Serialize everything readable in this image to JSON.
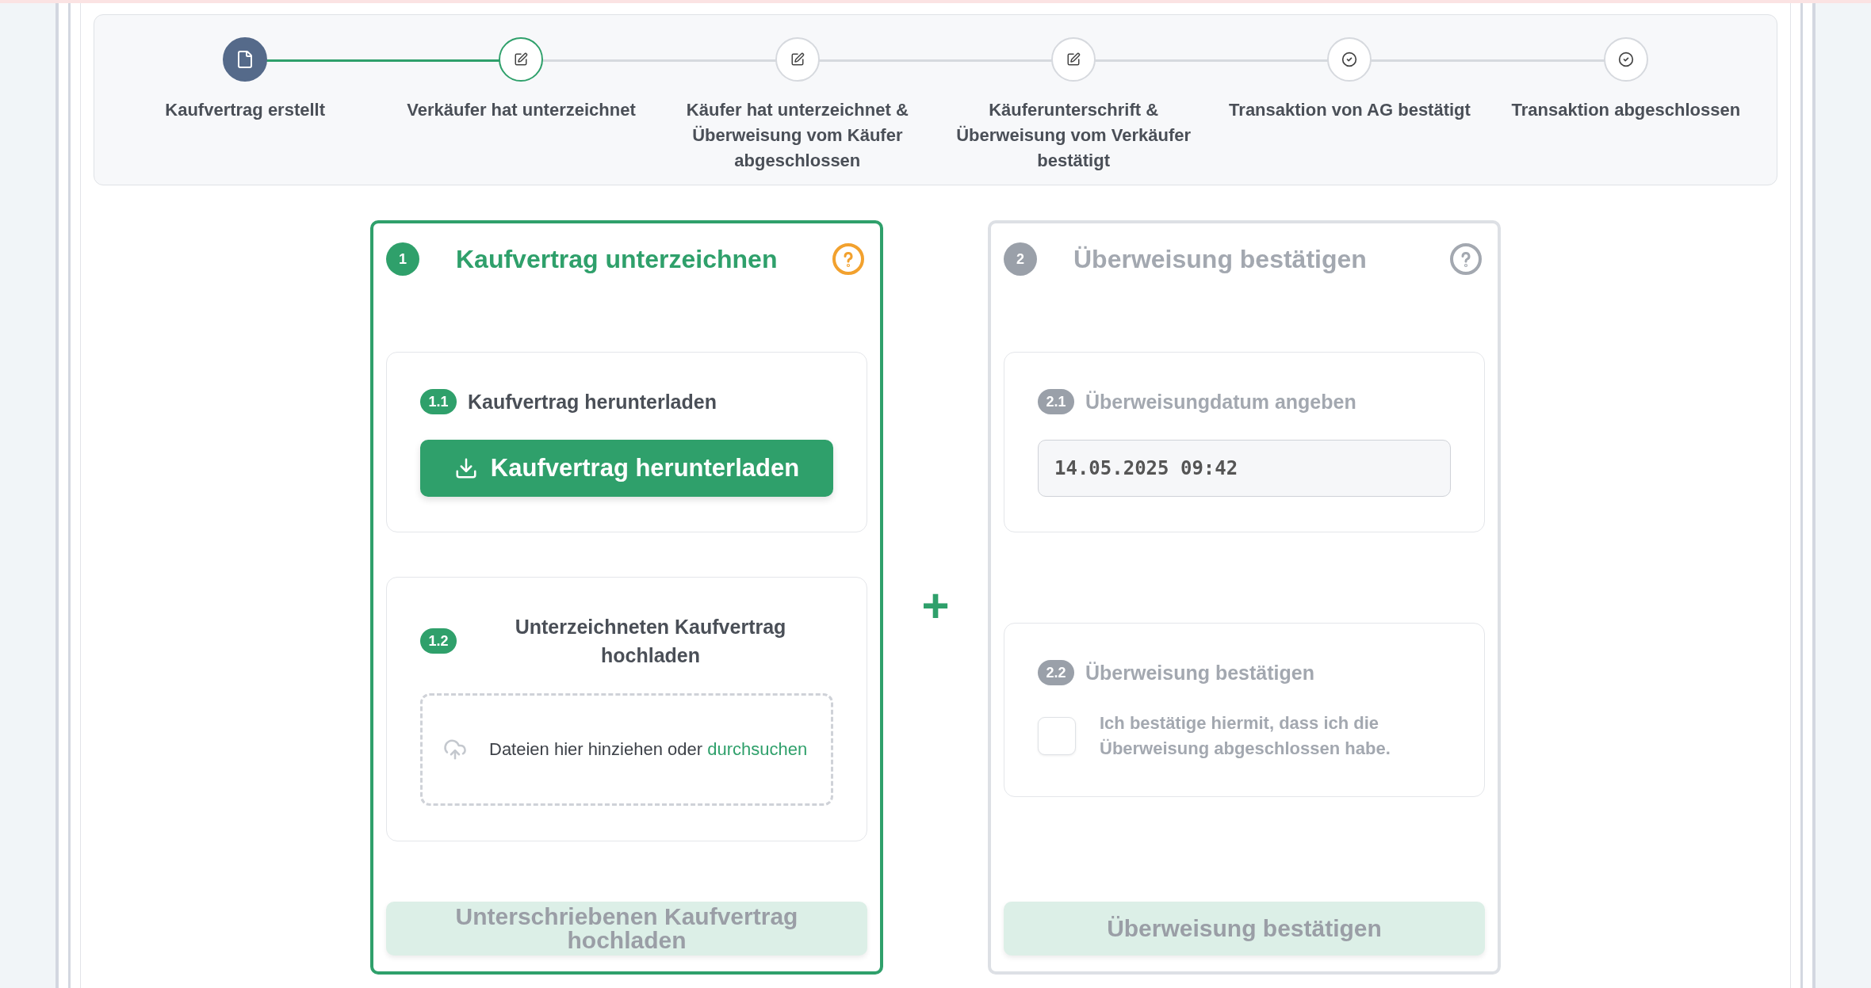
{
  "steps": [
    {
      "label": "Kaufvertrag erstellt",
      "done": true,
      "selected": false,
      "kind": "document"
    },
    {
      "label": "Verkäufer hat unterzeichnet",
      "done": false,
      "selected": true,
      "kind": "edit"
    },
    {
      "label": "Käufer hat unterzeichnet & Überweisung vom Käufer abgeschlossen",
      "done": false,
      "selected": false,
      "kind": "edit"
    },
    {
      "label": "Käuferunterschrift & Überweisung vom Verkäufer bestätigt",
      "done": false,
      "selected": false,
      "kind": "edit"
    },
    {
      "label": "Transaktion von AG bestätigt",
      "done": false,
      "selected": false,
      "kind": "check"
    },
    {
      "label": "Transaktion abgeschlossen",
      "done": false,
      "selected": false,
      "kind": "check"
    }
  ],
  "cards": [
    {
      "number": "1",
      "title": "Kaufvertrag unterzeichnen",
      "active": true,
      "sections": [
        {
          "kind": "download",
          "number": "1.1",
          "title": "Kaufvertrag herunterladen",
          "button": "Kaufvertrag herunterladen"
        },
        {
          "kind": "upload",
          "number": "1.2",
          "title": "Unterzeichneten Kaufvertrag hochladen",
          "dropzone_text": "Dateien hier hinziehen oder",
          "link": "durchsuchen"
        }
      ],
      "submit": "Unterschriebenen Kaufvertrag hochladen"
    },
    {
      "number": "2",
      "title": "Überweisung bestätigen",
      "active": false,
      "sections": [
        {
          "kind": "date",
          "number": "2.1",
          "title": "Überweisungdatum angeben",
          "value": "14.05.2025 09:42"
        },
        {
          "kind": "checkbox",
          "number": "2.2",
          "title": "Überweisung bestätigen",
          "checked": false,
          "label": "Ich bestätige hiermit, dass ich die Überweisung abgeschlossen habe."
        }
      ],
      "submit": "Überweisung bestätigen"
    }
  ],
  "separator": "+"
}
